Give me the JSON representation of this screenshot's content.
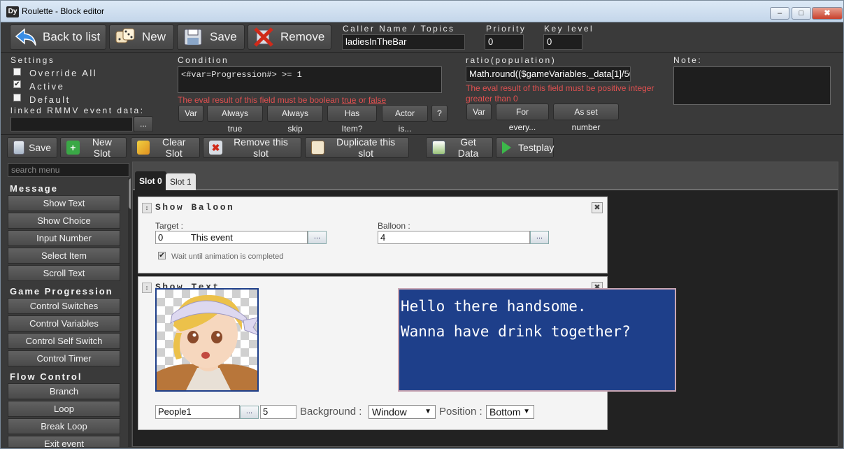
{
  "window": {
    "icon_text": "Dy",
    "title": "Roulette - Block editor",
    "min": "–",
    "max": "□",
    "close": "✖"
  },
  "toolbar": {
    "back": "Back to list",
    "new": "New",
    "save": "Save",
    "remove": "Remove",
    "caller_label": "Caller Name / Topics",
    "caller_value": "ladiesInTheBar",
    "priority_label": "Priority",
    "priority_value": "0",
    "key_label": "Key level",
    "key_value": "0"
  },
  "settings": {
    "label": "Settings",
    "override_all": "Override All",
    "active": "Active",
    "default": "Default",
    "active_checked": "✔",
    "linked_label": "linked RMMV event data:",
    "linked_value": "",
    "browse": "..."
  },
  "condition": {
    "label": "Condition",
    "value": "<#var=Progression#> >= 1",
    "note_pre": "The eval result of this field must be boolean ",
    "note_true": "true",
    "note_or": " or ",
    "note_false": "false",
    "buttons": [
      "Var",
      "Always true",
      "Always skip",
      "Has Item?",
      "Actor is...",
      "?"
    ]
  },
  "ratio": {
    "label": "ratio(population)",
    "value": "Math.round(($gameVariables._data[1]/50",
    "note": "The eval result of this field must be positive integer greater than 0",
    "buttons": [
      "Var",
      "For every...",
      "As set number"
    ]
  },
  "note": {
    "label": "Note:",
    "value": ""
  },
  "slotbar": {
    "save": "Save",
    "new_slot": "New Slot",
    "clear_slot": "Clear Slot",
    "remove_slot": "Remove this slot",
    "duplicate_slot": "Duplicate this slot",
    "get_data": "Get Data",
    "testplay": "Testplay"
  },
  "menu": {
    "search_placeholder": "search menu",
    "cat_message": "Message",
    "message_items": [
      "Show Text",
      "Show Choice",
      "Input Number",
      "Select Item",
      "Scroll Text"
    ],
    "cat_progression": "Game Progression",
    "progression_items": [
      "Control Switches",
      "Control Variables",
      "Control Self Switch",
      "Control Timer"
    ],
    "cat_flow": "Flow Control",
    "flow_items": [
      "Branch",
      "Loop",
      "Break Loop",
      "Exit event"
    ]
  },
  "tabs": [
    "Slot 0",
    "Slot 1"
  ],
  "balloon_block": {
    "title": "Show Baloon",
    "target_label": "Target :",
    "target_id": "0",
    "target_name": "This event",
    "balloon_label": "Balloon :",
    "balloon_value": "4",
    "wait_label": "Wait until animation is completed",
    "wait_checked": "✔",
    "browse": "..."
  },
  "text_block": {
    "title": "Show Text",
    "line1": "Hello there handsome.",
    "line2": "Wanna have drink together?",
    "face_value": "People1",
    "face_index": "5",
    "background_label": "Background :",
    "background_value": "Window",
    "position_label": "Position :",
    "position_value": "Bottom",
    "browse": "..."
  },
  "colors": {
    "accent_red": "#e05050",
    "message_bg": "#1e3f8a"
  }
}
